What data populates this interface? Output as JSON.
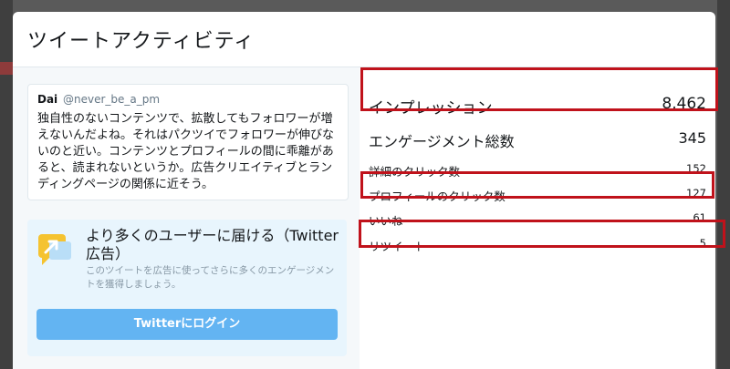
{
  "modal": {
    "title": "ツイートアクティビティ"
  },
  "tweet": {
    "name": "Dai",
    "handle": "@never_be_a_pm",
    "text": "独自性のないコンテンツで、拡散してもフォロワーが増えないんだよね。それはパクツイでフォロワーが伸びないのと近い。コンテンツとプロフィールの間に乖離があると、読まれないというか。広告クリエイティブとランディングページの関係に近そう。"
  },
  "promo": {
    "icon": "megaphone-icon",
    "heading": "より多くのユーザーに届ける（Twitter広告）",
    "subtext": "このツイートを広告に使ってさらに多くのエンゲージメントを獲得しましょう。",
    "button_label": "Twitterにログイン"
  },
  "stats": {
    "impressions": {
      "label": "インプレッション",
      "value": "8,462"
    },
    "engagements": {
      "label": "エンゲージメント総数",
      "value": "345"
    },
    "detail_clicks": {
      "label": "詳細のクリック数",
      "value": "152"
    },
    "profile_clicks": {
      "label": "プロフィールのクリック数",
      "value": "127"
    },
    "likes": {
      "label": "いいね",
      "value": "61"
    },
    "retweets": {
      "label": "リツイート",
      "value": "5"
    }
  },
  "colors": {
    "highlight": "#c0121b",
    "button": "#63b4f2",
    "promo_bg": "#e8f5fd"
  }
}
